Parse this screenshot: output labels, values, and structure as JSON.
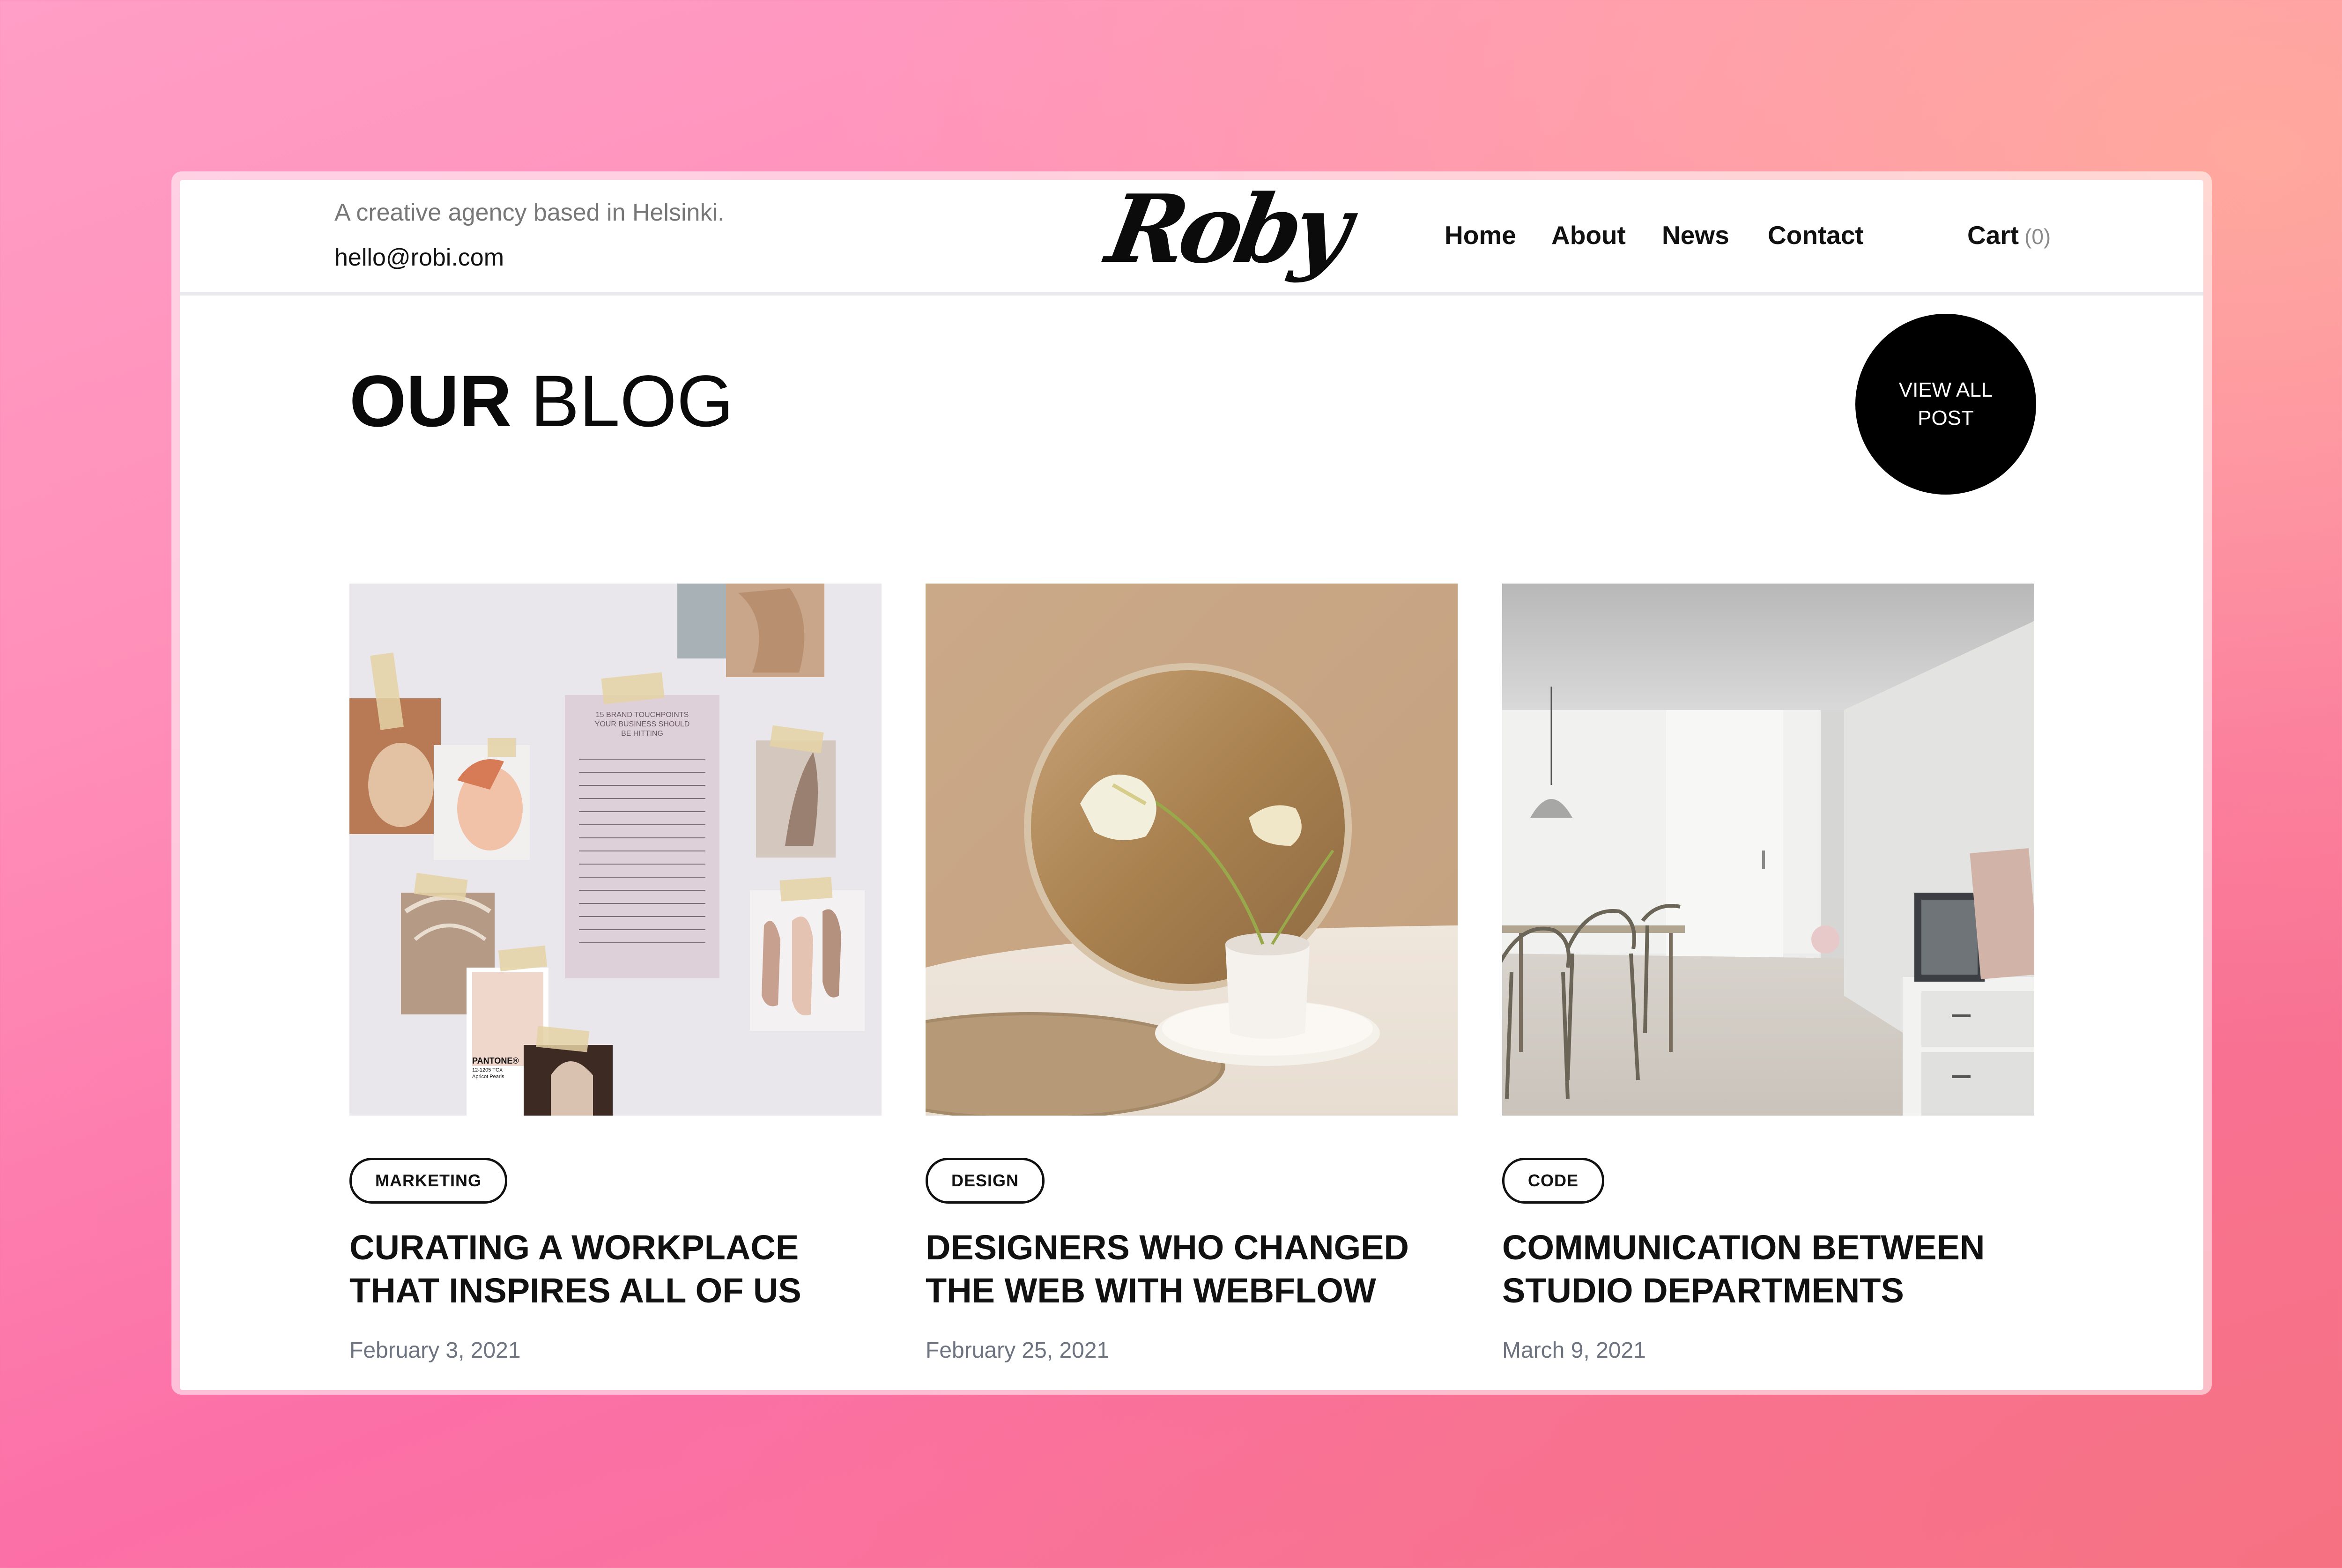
{
  "header": {
    "tagline": "A creative agency based in Helsinki.",
    "email": "hello@robi.com",
    "logo": "Roby",
    "nav": [
      {
        "label": "Home"
      },
      {
        "label": "About"
      },
      {
        "label": "News"
      },
      {
        "label": "Contact"
      }
    ],
    "cart": {
      "label": "Cart",
      "count": "(0)"
    }
  },
  "blog": {
    "title_bold": "OUR",
    "title_light": "BLOG",
    "view_all_label": "VIEW ALL POST",
    "posts": [
      {
        "tag": "MARKETING",
        "title": "CURATING A WORKPLACE THAT INSPIRES ALL OF US",
        "date": "February 3, 2021",
        "image": "moodboard-image",
        "image_text": {
          "heading": "15 BRAND TOUCHPOINTS YOUR BUSINESS SHOULD BE HITTING",
          "swatch": "PANTONE®",
          "swatch_code": "12-1205 TCX",
          "swatch_name": "Apricot Pearls"
        }
      },
      {
        "tag": "DESIGN",
        "title": "DESIGNERS WHO CHANGED THE WEB WITH WEBFLOW",
        "date": "February 25, 2021",
        "image": "mirror-flower-image"
      },
      {
        "tag": "CODE",
        "title": "COMMUNICATION BETWEEN STUDIO DEPARTMENTS",
        "date": "March 9, 2021",
        "image": "interior-dining-image"
      }
    ]
  },
  "colors": {
    "accent": "#000000",
    "text": "#111111",
    "muted": "#777777",
    "date": "#6e7380",
    "background_pink": "#fb6fa6"
  }
}
